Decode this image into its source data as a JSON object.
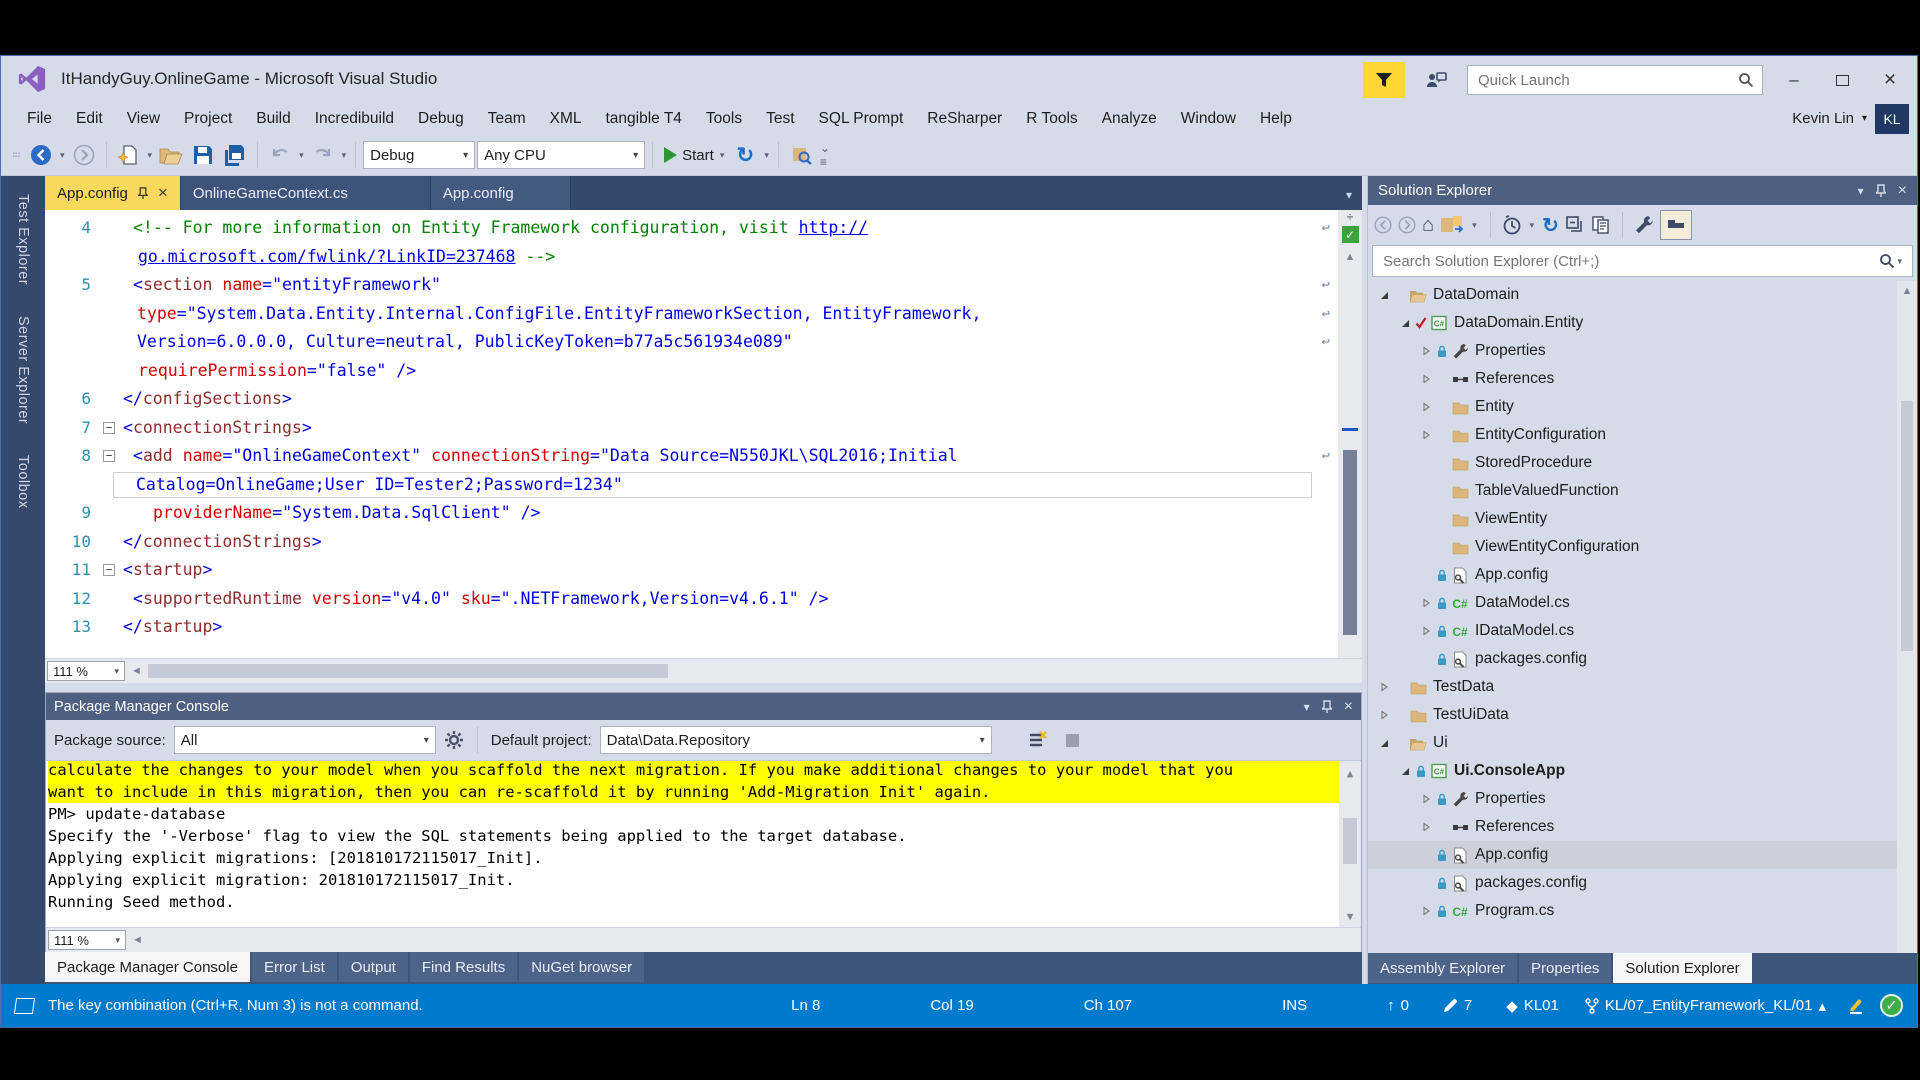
{
  "window": {
    "title": "ItHandyGuy.OnlineGame - Microsoft Visual Studio",
    "quick_launch_placeholder": "Quick Launch",
    "user_name": "Kevin Lin",
    "user_initials": "KL"
  },
  "menu": {
    "items": [
      "File",
      "Edit",
      "View",
      "Project",
      "Build",
      "Incredibuild",
      "Debug",
      "Team",
      "XML",
      "tangible T4",
      "Tools",
      "Test",
      "SQL Prompt",
      "ReSharper",
      "R Tools",
      "Analyze",
      "Window",
      "Help"
    ]
  },
  "toolbar": {
    "config_dropdown": "Debug",
    "platform_dropdown": "Any CPU",
    "start_label": "Start"
  },
  "left_tabs": {
    "items": [
      "Test Explorer",
      "Server Explorer",
      "Toolbox"
    ]
  },
  "editor": {
    "tabs": [
      {
        "label": "App.config",
        "active": true
      },
      {
        "label": "OnlineGameContext.cs",
        "active": false
      },
      {
        "label": "App.config",
        "active": false
      }
    ],
    "zoom": "111 %",
    "lines": [
      {
        "num": "4",
        "rows": [
          {
            "indent": 10,
            "wrap": true,
            "segs": [
              [
                "cm",
                "<!-- For more information on Entity Framework configuration, visit "
              ],
              [
                "lk",
                "http://"
              ]
            ]
          },
          {
            "indent": 15,
            "segs": [
              [
                "lk",
                "go.microsoft.com/fwlink/?LinkID=237468"
              ],
              [
                "cm",
                " -->"
              ]
            ]
          }
        ]
      },
      {
        "num": "5",
        "rows": [
          {
            "indent": 10,
            "wrap": true,
            "segs": [
              [
                "d",
                "<"
              ],
              [
                "el",
                "section"
              ],
              [
                "pl",
                " "
              ],
              [
                "at",
                "name"
              ],
              [
                "d",
                "="
              ],
              [
                "v",
                "\"entityFramework\""
              ]
            ]
          },
          {
            "indent": 14,
            "wrap": true,
            "segs": [
              [
                "at",
                "type"
              ],
              [
                "d",
                "="
              ],
              [
                "v",
                "\"System.Data.Entity.Internal.ConfigFile.EntityFrameworkSection, EntityFramework,"
              ]
            ]
          },
          {
            "indent": 14,
            "wrap": true,
            "segs": [
              [
                "v",
                "Version=6.0.0.0, Culture=neutral, PublicKeyToken=b77a5c561934e089\""
              ]
            ]
          },
          {
            "indent": 15,
            "segs": [
              [
                "at",
                "requirePermission"
              ],
              [
                "d",
                "="
              ],
              [
                "v",
                "\"false\""
              ],
              [
                "d",
                " />"
              ]
            ]
          }
        ]
      },
      {
        "num": "6",
        "rows": [
          {
            "indent": 0,
            "segs": [
              [
                "d",
                "</"
              ],
              [
                "el",
                "configSections"
              ],
              [
                "d",
                ">"
              ]
            ]
          }
        ]
      },
      {
        "num": "7",
        "fold": true,
        "rows": [
          {
            "indent": 0,
            "segs": [
              [
                "d",
                "<"
              ],
              [
                "el",
                "connectionStrings"
              ],
              [
                "d",
                ">"
              ]
            ]
          }
        ]
      },
      {
        "num": "8",
        "fold": true,
        "rows": [
          {
            "indent": 10,
            "wrap": true,
            "segs": [
              [
                "d",
                "<"
              ],
              [
                "el",
                "add"
              ],
              [
                "pl",
                " "
              ],
              [
                "at",
                "name"
              ],
              [
                "d",
                "="
              ],
              [
                "v",
                "\"OnlineGameContext\""
              ],
              [
                "pl",
                " "
              ],
              [
                "at",
                "connectionString"
              ],
              [
                "d",
                "="
              ],
              [
                "v",
                "\"Data Source=N550JKL\\SQL2016;Initial"
              ]
            ]
          },
          {
            "indent": 13,
            "current": true,
            "segs": [
              [
                "v",
                "Catalog=OnlineGame;User ID=Tester2;Password=1234\""
              ]
            ]
          }
        ]
      },
      {
        "num": "9",
        "rows": [
          {
            "indent": 30,
            "segs": [
              [
                "at",
                "providerName"
              ],
              [
                "d",
                "="
              ],
              [
                "v",
                "\"System.Data.SqlClient\""
              ],
              [
                "d",
                " />"
              ]
            ]
          }
        ]
      },
      {
        "num": "10",
        "rows": [
          {
            "indent": 0,
            "segs": [
              [
                "d",
                "</"
              ],
              [
                "el",
                "connectionStrings"
              ],
              [
                "d",
                ">"
              ]
            ]
          }
        ]
      },
      {
        "num": "11",
        "fold": true,
        "rows": [
          {
            "indent": 0,
            "segs": [
              [
                "d",
                "<"
              ],
              [
                "el",
                "startup"
              ],
              [
                "d",
                ">"
              ]
            ]
          }
        ]
      },
      {
        "num": "12",
        "rows": [
          {
            "indent": 10,
            "segs": [
              [
                "d",
                "<"
              ],
              [
                "el",
                "supportedRuntime"
              ],
              [
                "pl",
                " "
              ],
              [
                "at",
                "version"
              ],
              [
                "d",
                "="
              ],
              [
                "v",
                "\"v4.0\""
              ],
              [
                "pl",
                " "
              ],
              [
                "at",
                "sku"
              ],
              [
                "d",
                "="
              ],
              [
                "v",
                "\".NETFramework,Version=v4.6.1\""
              ],
              [
                "d",
                " />"
              ]
            ]
          }
        ]
      },
      {
        "num": "13",
        "rows": [
          {
            "indent": 0,
            "segs": [
              [
                "d",
                "</"
              ],
              [
                "el",
                "startup"
              ],
              [
                "d",
                ">"
              ]
            ]
          }
        ]
      }
    ]
  },
  "console_panel": {
    "title": "Package Manager Console",
    "package_source_label": "Package source:",
    "package_source_value": "All",
    "default_project_label": "Default project:",
    "default_project_value": "Data\\Data.Repository",
    "zoom": "111 %",
    "output": [
      {
        "text": "calculate the changes to your model when you scaffold the next migration. If you make additional changes to your model that you",
        "highlight": true,
        "clipped": true
      },
      {
        "text": "want to include in this migration, then you can re-scaffold it by running 'Add-Migration Init' again.",
        "highlight": true
      },
      {
        "text": "PM> update-database",
        "highlight": false
      },
      {
        "text": "Specify the '-Verbose' flag to view the SQL statements being applied to the target database.",
        "highlight": false
      },
      {
        "text": "Applying explicit migrations: [201810172115017_Init].",
        "highlight": false
      },
      {
        "text": "Applying explicit migration: 201810172115017_Init.",
        "highlight": false
      },
      {
        "text": "Running Seed method.",
        "highlight": false
      }
    ],
    "tabs": [
      {
        "label": "Package Manager Console",
        "active": true
      },
      {
        "label": "Error List",
        "active": false
      },
      {
        "label": "Output",
        "active": false
      },
      {
        "label": "Find Results",
        "active": false
      },
      {
        "label": "NuGet browser",
        "active": false
      }
    ]
  },
  "solution_explorer": {
    "title": "Solution Explorer",
    "search_placeholder": "Search Solution Explorer (Ctrl+;)",
    "tree": [
      {
        "label": "DataDomain",
        "indent": 0,
        "expand": "open",
        "icon": "folder-open",
        "mark": "",
        "bold": false,
        "selected": false
      },
      {
        "label": "DataDomain.Entity",
        "indent": 1,
        "expand": "open",
        "icon": "csproj",
        "mark": "check",
        "bold": false,
        "selected": false
      },
      {
        "label": "Properties",
        "indent": 2,
        "expand": "closed",
        "icon": "wrench",
        "mark": "lock",
        "bold": false,
        "selected": false
      },
      {
        "label": "References",
        "indent": 2,
        "expand": "closed",
        "icon": "references",
        "mark": "",
        "bold": false,
        "selected": false
      },
      {
        "label": "Entity",
        "indent": 2,
        "expand": "closed",
        "icon": "folder",
        "mark": "",
        "bold": false,
        "selected": false
      },
      {
        "label": "EntityConfiguration",
        "indent": 2,
        "expand": "closed",
        "icon": "folder",
        "mark": "",
        "bold": false,
        "selected": false
      },
      {
        "label": "StoredProcedure",
        "indent": 2,
        "expand": "",
        "icon": "folder",
        "mark": "",
        "bold": false,
        "selected": false
      },
      {
        "label": "TableValuedFunction",
        "indent": 2,
        "expand": "",
        "icon": "folder",
        "mark": "",
        "bold": false,
        "selected": false
      },
      {
        "label": "ViewEntity",
        "indent": 2,
        "expand": "",
        "icon": "folder",
        "mark": "",
        "bold": false,
        "selected": false
      },
      {
        "label": "ViewEntityConfiguration",
        "indent": 2,
        "expand": "",
        "icon": "folder",
        "mark": "",
        "bold": false,
        "selected": false
      },
      {
        "label": "App.config",
        "indent": 2,
        "expand": "",
        "icon": "config",
        "mark": "lock",
        "bold": false,
        "selected": false
      },
      {
        "label": "DataModel.cs",
        "indent": 2,
        "expand": "closed",
        "icon": "csfile",
        "mark": "lock",
        "bold": false,
        "selected": false
      },
      {
        "label": "IDataModel.cs",
        "indent": 2,
        "expand": "closed",
        "icon": "csfile",
        "mark": "lock",
        "bold": false,
        "selected": false
      },
      {
        "label": "packages.config",
        "indent": 2,
        "expand": "",
        "icon": "config",
        "mark": "lock",
        "bold": false,
        "selected": false
      },
      {
        "label": "TestData",
        "indent": 0,
        "expand": "closed",
        "icon": "folder",
        "mark": "",
        "bold": false,
        "selected": false
      },
      {
        "label": "TestUiData",
        "indent": 0,
        "expand": "closed",
        "icon": "folder",
        "mark": "",
        "bold": false,
        "selected": false
      },
      {
        "label": "Ui",
        "indent": 0,
        "expand": "open",
        "icon": "folder-open",
        "mark": "",
        "bold": false,
        "selected": false
      },
      {
        "label": "Ui.ConsoleApp",
        "indent": 1,
        "expand": "open",
        "icon": "csproj",
        "mark": "lock",
        "bold": true,
        "selected": false
      },
      {
        "label": "Properties",
        "indent": 2,
        "expand": "closed",
        "icon": "wrench",
        "mark": "lock",
        "bold": false,
        "selected": false
      },
      {
        "label": "References",
        "indent": 2,
        "expand": "closed",
        "icon": "references",
        "mark": "",
        "bold": false,
        "selected": false
      },
      {
        "label": "App.config",
        "indent": 2,
        "expand": "",
        "icon": "config",
        "mark": "lock",
        "bold": false,
        "selected": true
      },
      {
        "label": "packages.config",
        "indent": 2,
        "expand": "",
        "icon": "config",
        "mark": "lock",
        "bold": false,
        "selected": false
      },
      {
        "label": "Program.cs",
        "indent": 2,
        "expand": "closed",
        "icon": "csfile",
        "mark": "lock",
        "bold": false,
        "selected": false
      }
    ],
    "tabs": [
      {
        "label": "Assembly Explorer",
        "active": false
      },
      {
        "label": "Properties",
        "active": false
      },
      {
        "label": "Solution Explorer",
        "active": true
      }
    ]
  },
  "status_bar": {
    "message": "The key combination (Ctrl+R, Num 3) is not a command.",
    "line": "Ln 8",
    "col": "Col 19",
    "ch": "Ch 107",
    "mode": "INS",
    "incoming_count": "0",
    "pending_count": "7",
    "repo": "KL01",
    "branch": "KL/07_EntityFramework_KL/01"
  },
  "icon_glyphs": {
    "dropdown": "▾",
    "close": "×",
    "minimize": "–",
    "pin": "⊼",
    "scroll_up": "▲",
    "scroll_down": "▼",
    "scroll_left": "◄",
    "scroll_right": "►",
    "up_arrow": "↑",
    "diamond": "◆",
    "check": "✓",
    "home": "⌂",
    "refresh": "↻",
    "fold_collapse": "−",
    "publish_up": "▴"
  },
  "palette": {
    "status_blue": "#007acc",
    "active_tab_yellow": "#f9d95d",
    "panel_header": "#4d6082",
    "chrome": "#d6dbe9",
    "dark_strip": "#35496d",
    "console_highlight": "#ffff00",
    "comment_green": "#008000",
    "xml_element": "#8c2e2e",
    "xml_attr": "#d40000",
    "xml_value": "#0000e8"
  }
}
